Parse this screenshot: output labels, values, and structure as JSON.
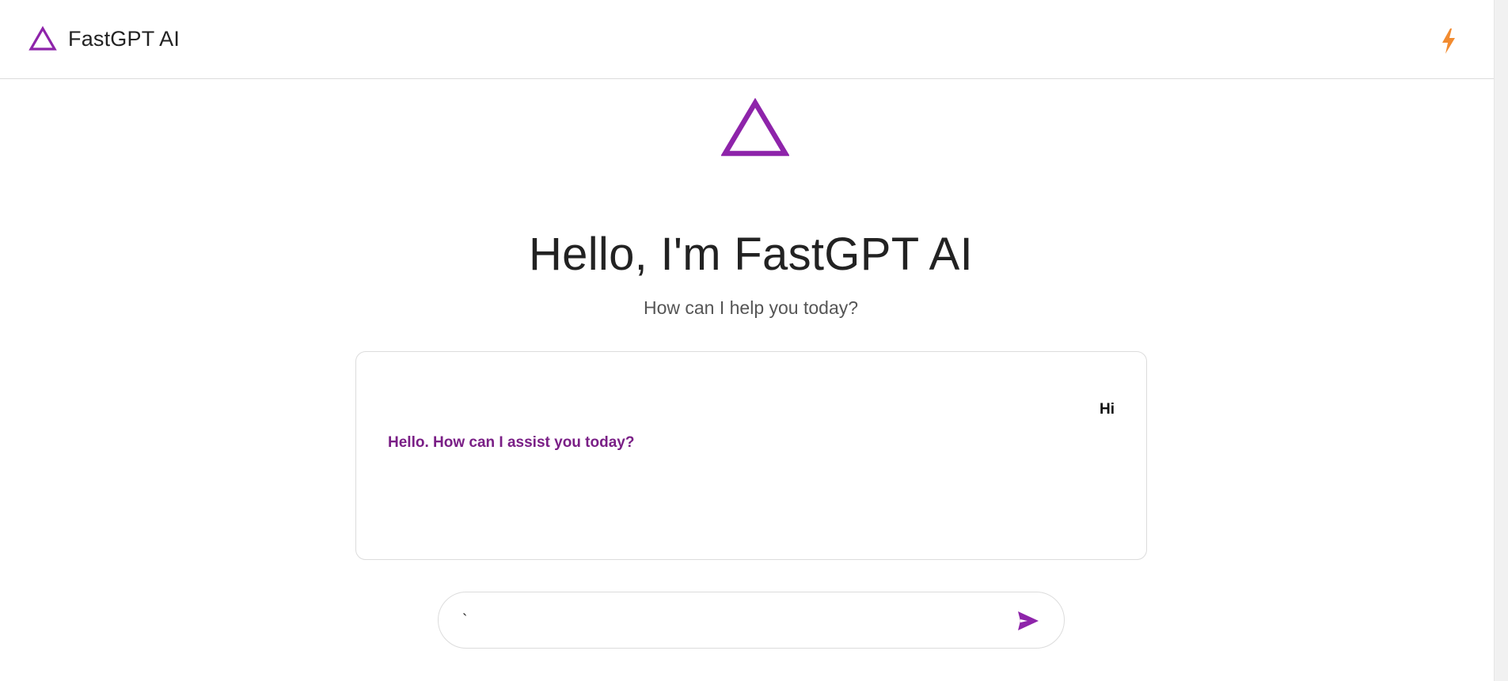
{
  "header": {
    "app_name": "FastGPT AI",
    "logo_icon": "triangle-logo-icon",
    "action_icon": "lightning-bolt-icon"
  },
  "hero": {
    "logo_icon": "triangle-logo-icon",
    "greeting": "Hello, I'm FastGPT AI",
    "subtitle": "How can I help you today?"
  },
  "chat": {
    "messages": [
      {
        "role": "user",
        "text": "Hi"
      },
      {
        "role": "assistant",
        "text": "Hello. How can I assist you today?"
      }
    ]
  },
  "composer": {
    "value": "`",
    "placeholder": "",
    "send_icon": "send-icon"
  },
  "colors": {
    "brand": "#8e24aa",
    "assistant_text": "#7a1f86",
    "accent_bolt": "#f28b30",
    "border": "#dcdcdc"
  }
}
